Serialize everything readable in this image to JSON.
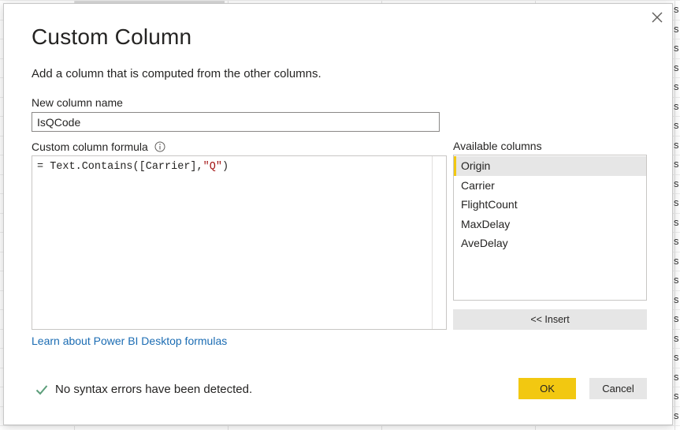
{
  "dialog": {
    "title": "Custom Column",
    "subtitle": "Add a column that is computed from the other columns.",
    "name_label": "New column name",
    "name_value": "IsQCode",
    "formula_label": "Custom column formula",
    "formula": {
      "prefix": "= Text.Contains([Carrier],",
      "string": "\"Q\"",
      "suffix": ")"
    },
    "learn_link": "Learn about Power BI Desktop formulas",
    "available_label": "Available columns",
    "available_columns": [
      "Origin",
      "Carrier",
      "FlightCount",
      "MaxDelay",
      "AveDelay"
    ],
    "selected_column": "Origin",
    "insert_label": "<< Insert",
    "status_text": "No syntax errors have been detected.",
    "ok_label": "OK",
    "cancel_label": "Cancel"
  },
  "background": {
    "right_edge_glyph": "s"
  },
  "colors": {
    "accent": "#f2c811",
    "link": "#1b6cb3",
    "success": "#5c9e7a",
    "string_literal": "#a31515"
  },
  "icons": {
    "close": "close-icon",
    "info": "info-icon",
    "check": "check-icon"
  }
}
